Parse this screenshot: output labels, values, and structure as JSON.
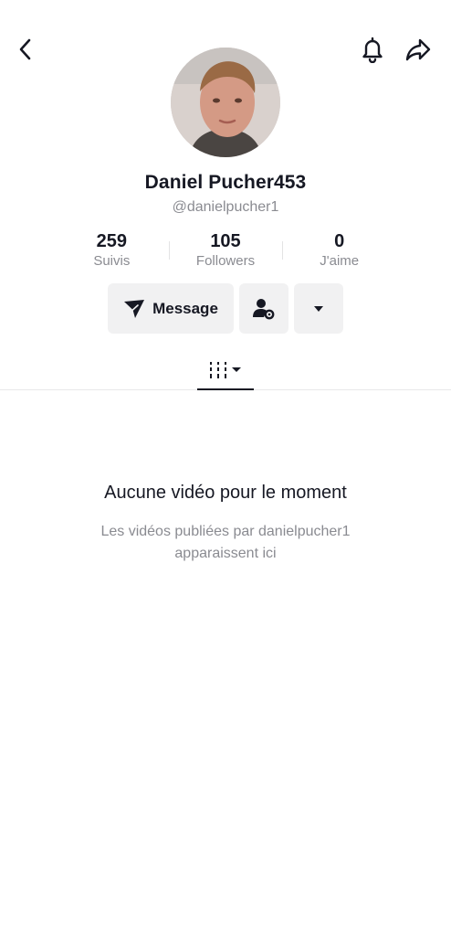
{
  "header": {
    "back_icon": "chevron-left-icon",
    "bell_icon": "bell-icon",
    "share_icon": "share-arrow-icon"
  },
  "profile": {
    "display_name": "Daniel Pucher453",
    "handle": "@danielpucher1"
  },
  "stats": [
    {
      "value": "259",
      "label": "Suivis"
    },
    {
      "value": "105",
      "label": "Followers"
    },
    {
      "value": "0",
      "label": "J'aime"
    }
  ],
  "actions": {
    "message_label": "Message",
    "message_icon": "send-icon",
    "friend_icon": "person-settings-icon",
    "more_icon": "caret-down-icon"
  },
  "tabs": {
    "videos_icon": "grid-icon"
  },
  "empty_state": {
    "title": "Aucune vidéo pour le moment",
    "subtitle": "Les vidéos publiées par danielpucher1 apparaissent ici"
  }
}
